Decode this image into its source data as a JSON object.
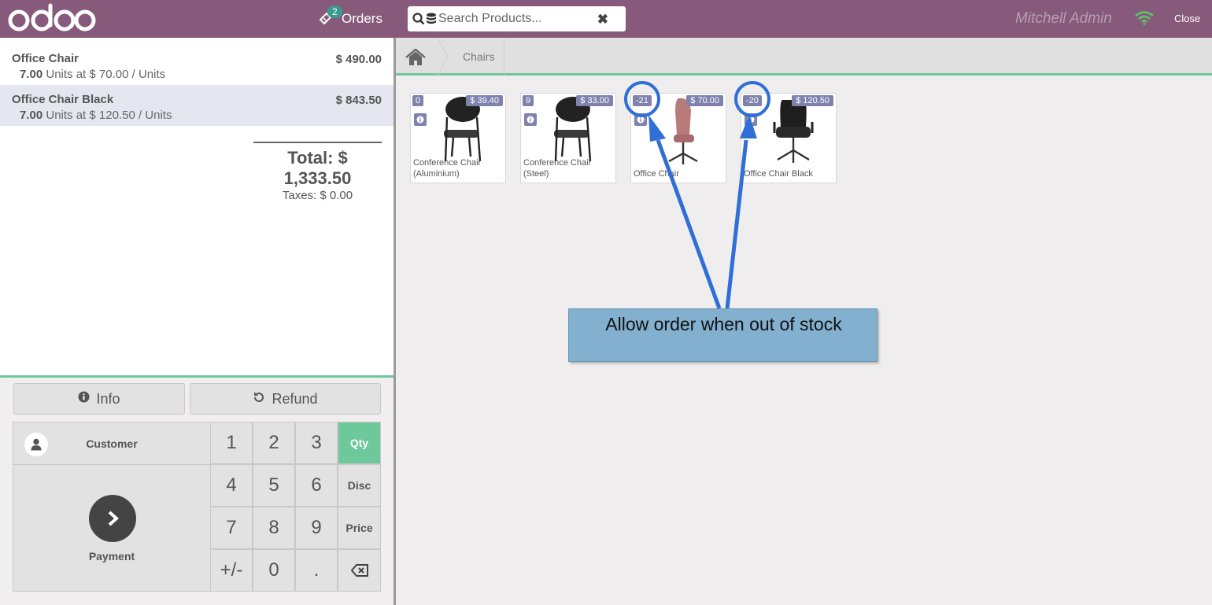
{
  "header": {
    "orders_label": "Orders",
    "orders_count": "2",
    "search_placeholder": "Search Products...",
    "user_name": "Mitchell Admin",
    "close_label": "Close"
  },
  "order": {
    "lines": [
      {
        "name": "Office Chair",
        "price": "$ 490.00",
        "qty": "7.00",
        "detail": "Units at $ 70.00 / Units"
      },
      {
        "name": "Office Chair Black",
        "price": "$ 843.50",
        "qty": "7.00",
        "detail": "Units at $ 120.50 / Units"
      }
    ],
    "total": "Total: $ 1,333.50",
    "taxes": "Taxes: $ 0.00"
  },
  "actions": {
    "info": "Info",
    "refund": "Refund",
    "customer": "Customer",
    "payment": "Payment"
  },
  "numpad": {
    "k1": "1",
    "k2": "2",
    "k3": "3",
    "k4": "4",
    "k5": "5",
    "k6": "6",
    "k7": "7",
    "k8": "8",
    "k9": "9",
    "sign": "+/-",
    "k0": "0",
    "dot": ".",
    "qty": "Qty",
    "disc": "Disc",
    "price": "Price"
  },
  "breadcrumb": {
    "category": "Chairs"
  },
  "products": [
    {
      "name": "Conference Chair (Aluminium)",
      "qty": "0",
      "price": "$ 39.40"
    },
    {
      "name": "Conference Chair (Steel)",
      "qty": "9",
      "price": "$ 33.00"
    },
    {
      "name": "Office Chair",
      "qty": "-21",
      "price": "$ 70.00"
    },
    {
      "name": "Office Chair Black",
      "qty": "-20",
      "price": "$ 120.50"
    }
  ],
  "annotation": {
    "text": "Allow order when out of stock"
  },
  "colors": {
    "brand": "#875a7b",
    "accent": "#6ec89b",
    "badge": "#7f82ac",
    "annotation": "#2f6fd6"
  }
}
